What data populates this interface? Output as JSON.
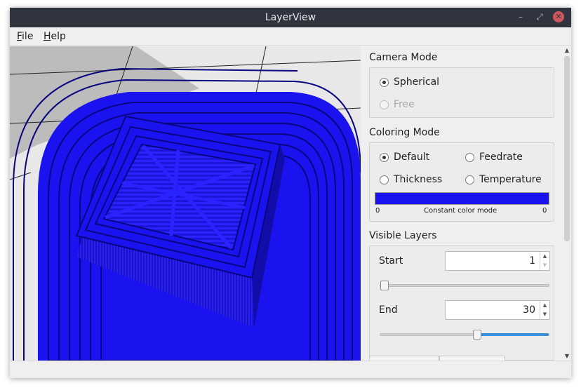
{
  "window": {
    "title": "LayerView"
  },
  "menu": {
    "file": {
      "mnemonic": "F",
      "rest": "ile"
    },
    "help": {
      "mnemonic": "H",
      "rest": "elp"
    }
  },
  "titlebar_icons": {
    "minimize": "minimize-icon",
    "maximize": "maximize-icon",
    "close": "close-icon"
  },
  "camera": {
    "title": "Camera Mode",
    "options": [
      {
        "label": "Spherical",
        "checked": true,
        "enabled": true
      },
      {
        "label": "Free",
        "checked": false,
        "enabled": false
      }
    ]
  },
  "coloring": {
    "title": "Coloring Mode",
    "options": [
      {
        "label": "Default",
        "checked": true
      },
      {
        "label": "Feedrate",
        "checked": false
      },
      {
        "label": "Thickness",
        "checked": false
      },
      {
        "label": "Temperature",
        "checked": false
      }
    ],
    "colorbar": {
      "color": "#1a13f0",
      "min_label": "0",
      "max_label": "0",
      "caption": "Constant color mode"
    }
  },
  "layers": {
    "title": "Visible Layers",
    "start": {
      "label": "Start",
      "value": "1",
      "slider_fraction": 0.0
    },
    "end": {
      "label": "End",
      "value": "30",
      "slider_fraction": 0.58
    }
  },
  "viewport": {
    "model_color": "#1a13f0",
    "background": "#d7d7d7"
  }
}
